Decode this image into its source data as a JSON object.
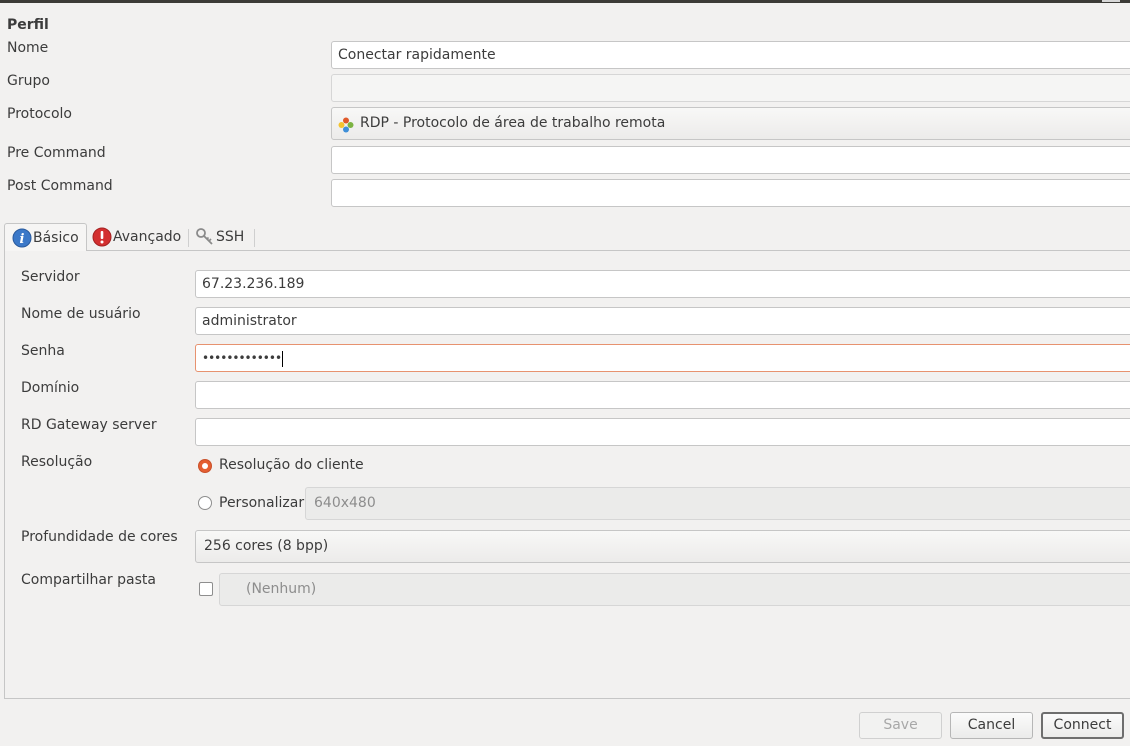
{
  "profile": {
    "section_title": "Perfil",
    "name_label": "Nome",
    "name_value": "Conectar rapidamente",
    "group_label": "Grupo",
    "group_value": "",
    "protocol_label": "Protocolo",
    "protocol_value": "RDP - Protocolo de área de trabalho remota",
    "pre_command_label": "Pre Command",
    "pre_command_value": "",
    "post_command_label": "Post Command",
    "post_command_value": ""
  },
  "tabs": [
    {
      "label": "Básico",
      "icon": "info-icon",
      "active": true
    },
    {
      "label": "Avançado",
      "icon": "warning-icon",
      "active": false
    },
    {
      "label": "SSH",
      "icon": "ssh-keys-icon",
      "active": false
    }
  ],
  "basic": {
    "server_label": "Servidor",
    "server_value": "67.23.236.189",
    "username_label": "Nome de usuário",
    "username_value": "administrator",
    "password_label": "Senha",
    "password_value": "•••••••••••••",
    "domain_label": "Domínio",
    "domain_value": "",
    "gateway_label": "RD Gateway server",
    "gateway_value": "",
    "resolution_label": "Resolução",
    "resolution_client_label": "Resolução do cliente",
    "resolution_custom_label": "Personalizar",
    "resolution_custom_value": "640x480",
    "color_depth_label": "Profundidade de cores",
    "color_depth_value": "256 cores (8 bpp)",
    "share_folder_label": "Compartilhar pasta",
    "share_folder_value": "(Nenhum)"
  },
  "buttons": {
    "save": "Save",
    "cancel": "Cancel",
    "connect": "Connect"
  },
  "colors": {
    "accent": "#e45e31",
    "window_bg": "#f2f1f0"
  }
}
